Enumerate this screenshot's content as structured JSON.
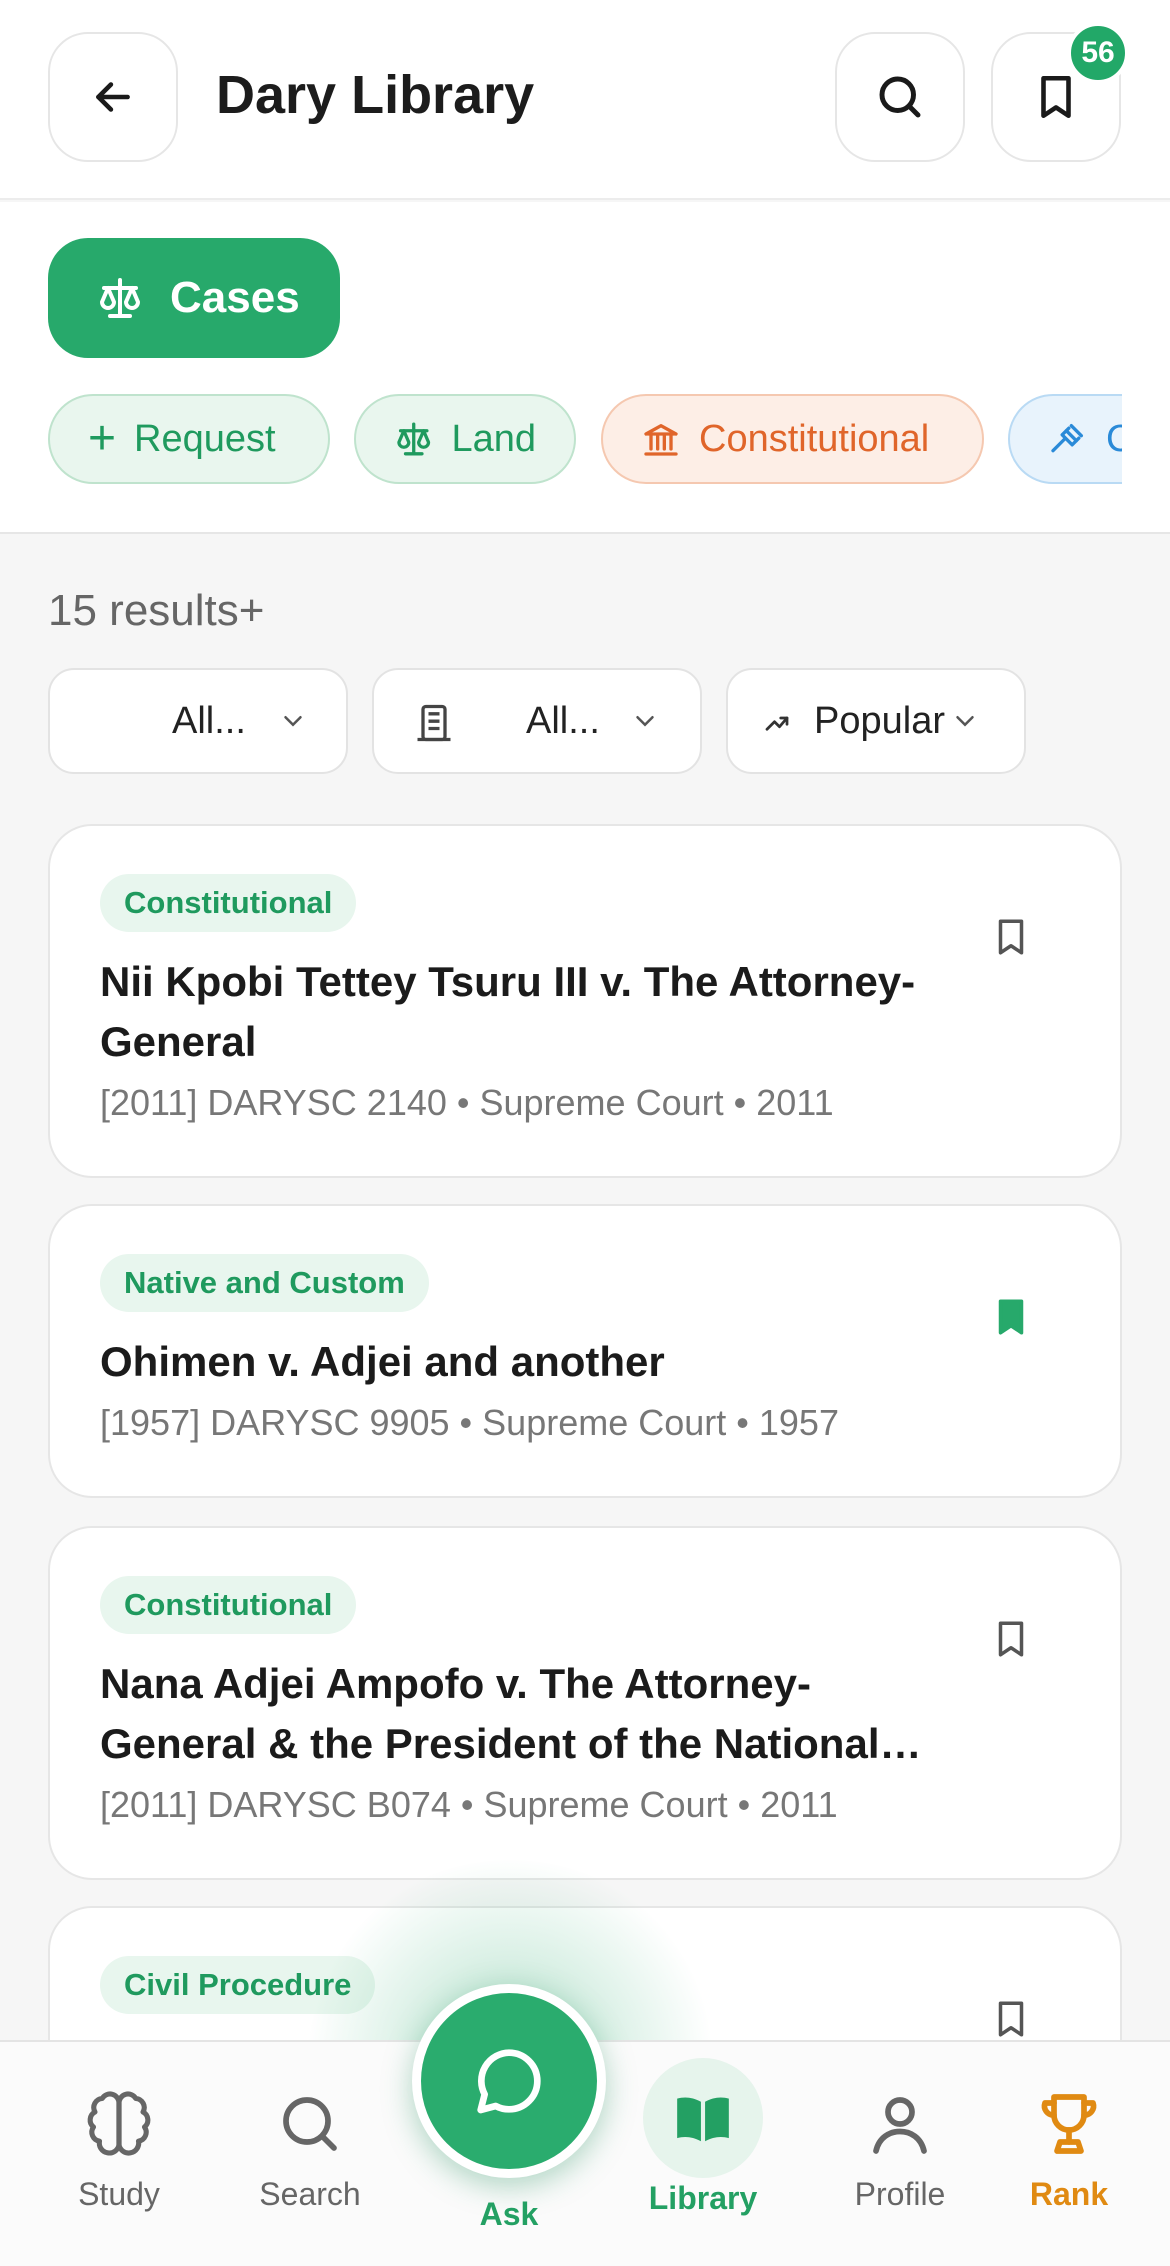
{
  "header": {
    "title": "Dary Library",
    "saved_count": "56"
  },
  "categories": {
    "active_tab": "Cases",
    "chips": [
      {
        "label": "Request"
      },
      {
        "label": "Land"
      },
      {
        "label": "Constitutional"
      },
      {
        "label": "C"
      }
    ]
  },
  "results": {
    "count_text": "15 results+"
  },
  "filters": [
    {
      "label": "All..."
    },
    {
      "label": "All..."
    },
    {
      "label": "Popular"
    }
  ],
  "cases": [
    {
      "tag": "Constitutional",
      "title": "Nii Kpobi Tettey Tsuru III v. The Attorney-General",
      "meta": "[2011] DARYSC 2140 • Supreme Court • 2011",
      "bookmarked": false
    },
    {
      "tag": "Native and Custom",
      "title": "Ohimen v. Adjei and another",
      "meta": "[1957] DARYSC 9905 • Supreme Court • 1957",
      "bookmarked": true
    },
    {
      "tag": "Constitutional",
      "title": "Nana Adjei Ampofo v. The Attorney-General & the President of the National…",
      "meta": "[2011] DARYSC B074 • Supreme Court • 2011",
      "bookmarked": false
    },
    {
      "tag": "Civil Procedure",
      "bookmarked": false
    }
  ],
  "nav": {
    "study": "Study",
    "search": "Search",
    "ask": "Ask",
    "library": "Library",
    "profile": "Profile",
    "rank": "Rank"
  },
  "colors": {
    "primary": "#27a96b",
    "orange": "#e0652a",
    "blue": "#2a8ad8",
    "rank": "#e08a12"
  }
}
